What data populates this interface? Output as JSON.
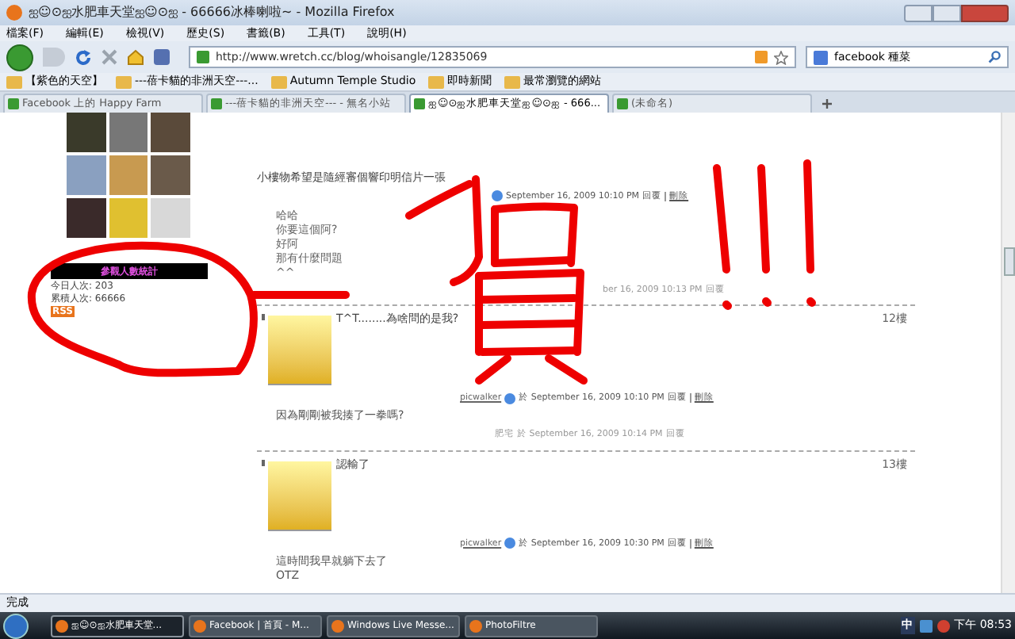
{
  "window": {
    "title": "ஐ☺⊙ஐ水肥車天堂ஐ☺⊙ஐ - 66666冰棒喇啦~ - Mozilla Firefox"
  },
  "menu": [
    "檔案(F)",
    "編輯(E)",
    "檢視(V)",
    "歷史(S)",
    "書籤(B)",
    "工具(T)",
    "說明(H)"
  ],
  "nav": {
    "url": "http://www.wretch.cc/blog/whoisangle/12835069",
    "search": "facebook 種菜"
  },
  "bookmarks": [
    "【紫色的天空】",
    "---蓓卡貓的非洲天空---...",
    "Autumn Temple Studio",
    "即時新聞",
    "最常瀏覽的網站"
  ],
  "tabs": [
    {
      "label": "Facebook 上的 Happy Farm",
      "selected": false
    },
    {
      "label": "---蓓卡貓的非洲天空--- - 無名小站",
      "selected": false
    },
    {
      "label": "ஐ☺⊙ஐ水肥車天堂ஐ☺⊙ஐ - 666...",
      "selected": true
    },
    {
      "label": "(未命名)",
      "selected": false
    }
  ],
  "sidebar": {
    "counter_banner": "參觀人數統計",
    "stats": [
      "今日人次: 203",
      "累積人次: 66666"
    ],
    "rss": "RSS"
  },
  "post": {
    "text": "小樓物希望是隨經審個響印明信片一張",
    "date": "September 16, 2009 10:10 PM",
    "actions": [
      "回覆",
      "刪除"
    ],
    "reply_lines": [
      "哈哈",
      "你要這個阿?",
      "好阿",
      "那有什麼問題",
      "^^"
    ],
    "reply_meta": "ber 16, 2009 10:13 PM",
    "reply_action": "回覆"
  },
  "comments": [
    {
      "title": "T^T........為啥問的是我?",
      "floor": "12樓",
      "author": "picwalker",
      "date": "於 September 16, 2009 10:10 PM",
      "actions": [
        "回覆",
        "刪除"
      ],
      "reply_lines": [
        "因為剛剛被我揍了一拳嗎?"
      ],
      "reply_author": "肥宅",
      "reply_date": "於 September 16, 2009 10:14 PM",
      "reply_action": "回覆"
    },
    {
      "title": "認輸了",
      "floor": "13樓",
      "author": "picwalker",
      "date": "於 September 16, 2009 10:30 PM",
      "actions": [
        "回覆",
        "刪除"
      ],
      "reply_lines": [
        "這時間我早就躺下去了",
        "OTZ"
      ]
    }
  ],
  "status_bar": "完成",
  "taskbar": {
    "tasks": [
      {
        "label": "ஐ☺⊙ஐ水肥車天堂...",
        "selected": true
      },
      {
        "label": "Facebook | 首頁 - M...",
        "selected": false
      },
      {
        "label": "Windows Live Messe...",
        "selected": false
      },
      {
        "label": "PhotoFiltre",
        "selected": false
      }
    ],
    "ime": "中",
    "clock": "下午 08:53"
  }
}
